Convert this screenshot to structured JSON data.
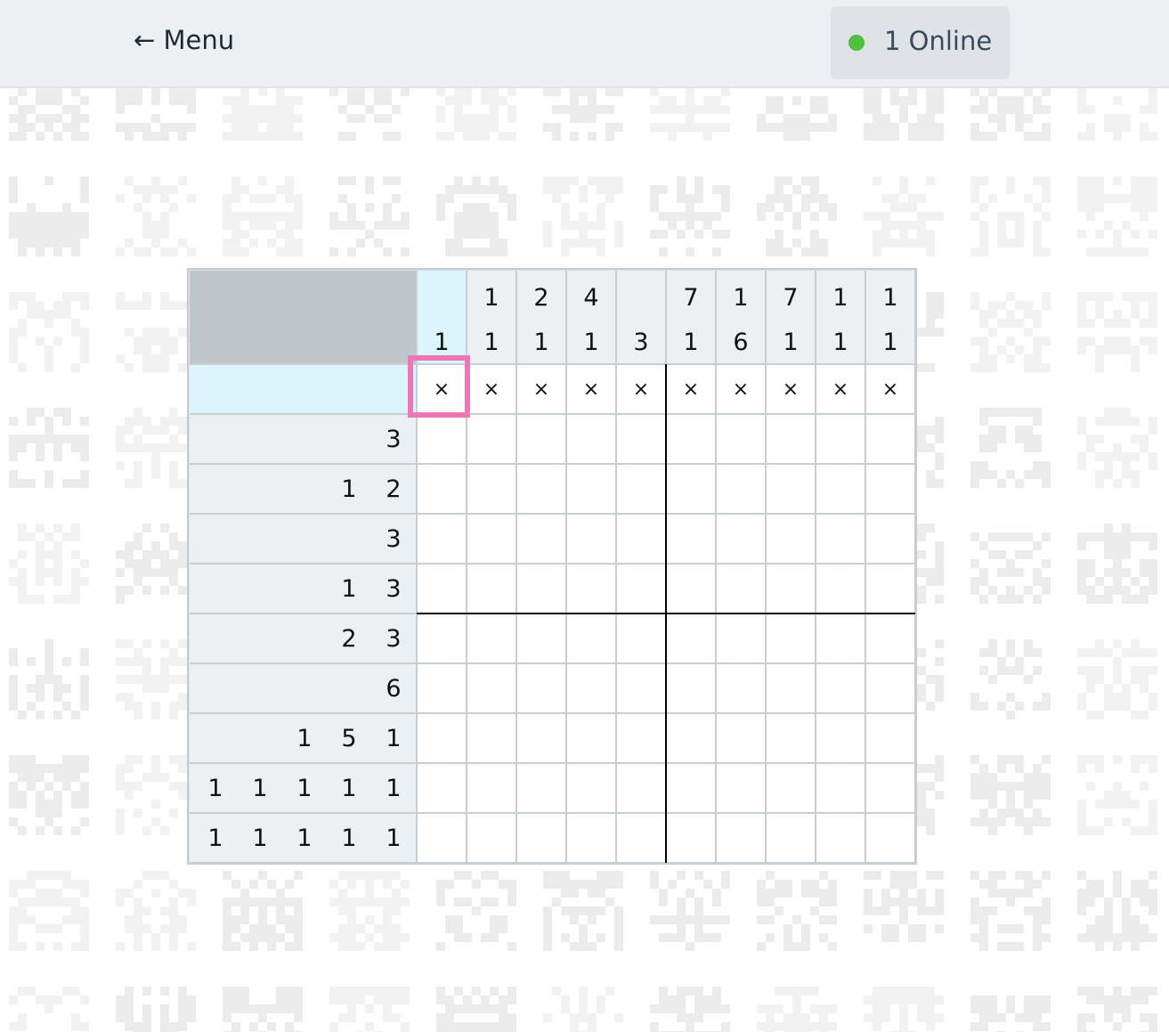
{
  "header": {
    "menu_label": "← Menu",
    "online_label": "1 Online",
    "online_status_color": "#4fc13a"
  },
  "puzzle": {
    "cols": 10,
    "rows": 10,
    "column_clues": [
      [
        "1"
      ],
      [
        "1",
        "1"
      ],
      [
        "2",
        "1"
      ],
      [
        "4",
        "1"
      ],
      [
        "3"
      ],
      [
        "7",
        "1"
      ],
      [
        "1",
        "6"
      ],
      [
        "7",
        "1"
      ],
      [
        "1",
        "1"
      ],
      [
        "1",
        "1"
      ]
    ],
    "row_clues": [
      [],
      [
        "3"
      ],
      [
        "1",
        "2"
      ],
      [
        "3"
      ],
      [
        "1",
        "3"
      ],
      [
        "2",
        "3"
      ],
      [
        "6"
      ],
      [
        "1",
        "5",
        "1"
      ],
      [
        "1",
        "1",
        "1",
        "1",
        "1"
      ],
      [
        "1",
        "1",
        "1",
        "1",
        "1"
      ]
    ],
    "crossed_cells": [
      [
        0,
        0
      ],
      [
        0,
        1
      ],
      [
        0,
        2
      ],
      [
        0,
        3
      ],
      [
        0,
        4
      ],
      [
        0,
        5
      ],
      [
        0,
        6
      ],
      [
        0,
        7
      ],
      [
        0,
        8
      ],
      [
        0,
        9
      ]
    ],
    "cross_glyph": "×",
    "cursor_cell": [
      0,
      0
    ],
    "highlight_column": 0,
    "highlight_row": 0,
    "colors": {
      "clue_bg": "#edf0f3",
      "corner_bg": "#c0c7cb",
      "highlight_bg": "#dcf4fb",
      "cursor": "#ef76b4",
      "grid_line": "#c9ced3",
      "major_line": "#000000"
    }
  }
}
